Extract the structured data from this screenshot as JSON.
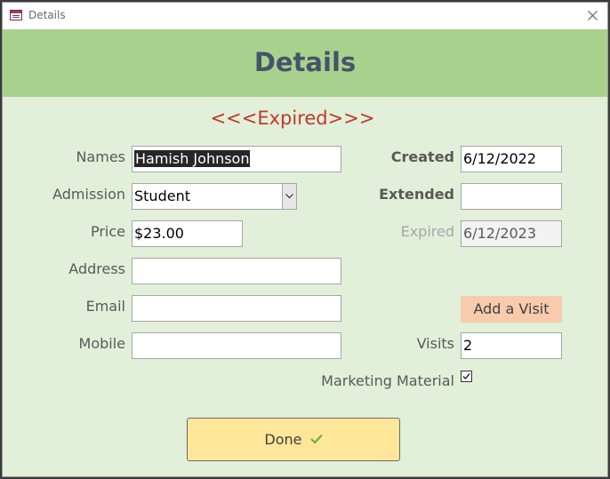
{
  "window": {
    "title": "Details"
  },
  "header": {
    "title": "Details"
  },
  "status": {
    "text": "<<<Expired>>>"
  },
  "form": {
    "names_label": "Names",
    "names_value": "Hamish Johnson",
    "admission_label": "Admission",
    "admission_value": "Student",
    "price_label": "Price",
    "price_value": "$23.00",
    "address_label": "Address",
    "address_value": "",
    "email_label": "Email",
    "email_value": "",
    "mobile_label": "Mobile",
    "mobile_value": "",
    "created_label": "Created",
    "created_value": "6/12/2022",
    "extended_label": "Extended",
    "extended_value": "",
    "expired_label": "Expired",
    "expired_value": "6/12/2023",
    "visits_label": "Visits",
    "visits_value": "2",
    "marketing_label": "Marketing Material",
    "marketing_checked": true
  },
  "buttons": {
    "add_visit": "Add a Visit",
    "done": "Done"
  },
  "colors": {
    "header_band": "#a9d18e",
    "form_background": "#e2efd9",
    "title_text": "#44546a",
    "status_text": "#c0392b",
    "add_visit_button": "#f8cbad",
    "done_button": "#ffe699",
    "done_check": "#70ad47"
  },
  "icons": {
    "app": "form-icon",
    "close": "close-icon",
    "dropdown": "chevron-down-icon",
    "checkbox": "checkmark-icon",
    "done": "checkmark-icon"
  }
}
